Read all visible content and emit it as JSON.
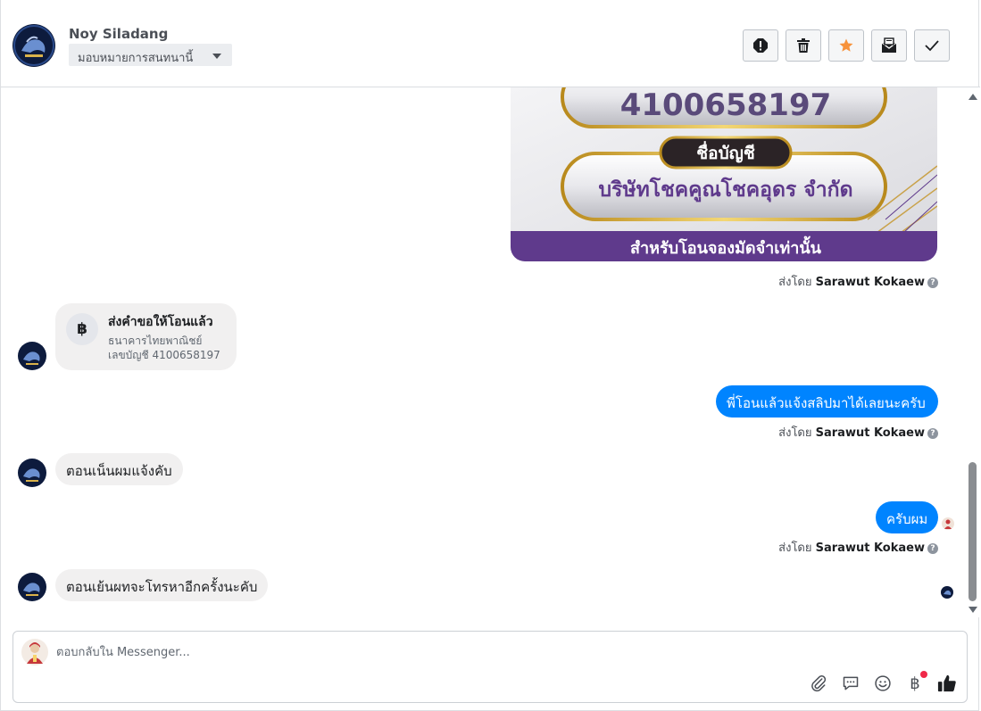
{
  "contact": {
    "name": "Noy Siladang",
    "assign_label": "มอบหมายการสนทนานี้"
  },
  "toolbar": [
    {
      "icon": "alert-icon",
      "name": "spam-button"
    },
    {
      "icon": "trash-icon",
      "name": "delete-button"
    },
    {
      "icon": "star-icon",
      "name": "star-button"
    },
    {
      "icon": "mark-unread-icon",
      "name": "mark-unread-button"
    },
    {
      "icon": "check-icon",
      "name": "mark-done-button"
    }
  ],
  "card": {
    "account_number": "4100658197",
    "account_name_label": "ชื่อบัญชี",
    "account_name": "บริษัทโชคคูณโชคอุดร จำกัด",
    "footer": "สำหรับโอนจองมัดจำเท่านั้น"
  },
  "sent_by": {
    "prefix": "ส่งโดย",
    "agent": "Sarawut Kokaew"
  },
  "payment_request": {
    "title": "ส่งคำขอให้โอนแล้ว",
    "bank": "ธนาคารไทยพาณิชย์",
    "account": "เลขบัญชี 4100658197",
    "currency_symbol": "฿"
  },
  "messages": [
    {
      "direction": "out",
      "text": "พี่โอนแล้วแจ้งสลิปมาได้เลยนะครับ"
    },
    {
      "direction": "in",
      "text": "ตอนเน็นผมแจ้งคับ"
    },
    {
      "direction": "out",
      "text": "ครับผม"
    },
    {
      "direction": "in",
      "text": "ตอนเย้นผทจะโทรหาอีกครั้งนะคับ"
    }
  ],
  "composer": {
    "placeholder": "ตอบกลับใน Messenger...",
    "tools": [
      "attach-icon",
      "saved-reply-icon",
      "emoji-icon",
      "baht-payment-icon",
      "thumbs-up-icon"
    ]
  },
  "colors": {
    "accent": "#0084ff",
    "card_purple": "#5f3a8c",
    "incoming": "#f1f0f0",
    "star": "#f7923b",
    "notification": "#f02849"
  }
}
